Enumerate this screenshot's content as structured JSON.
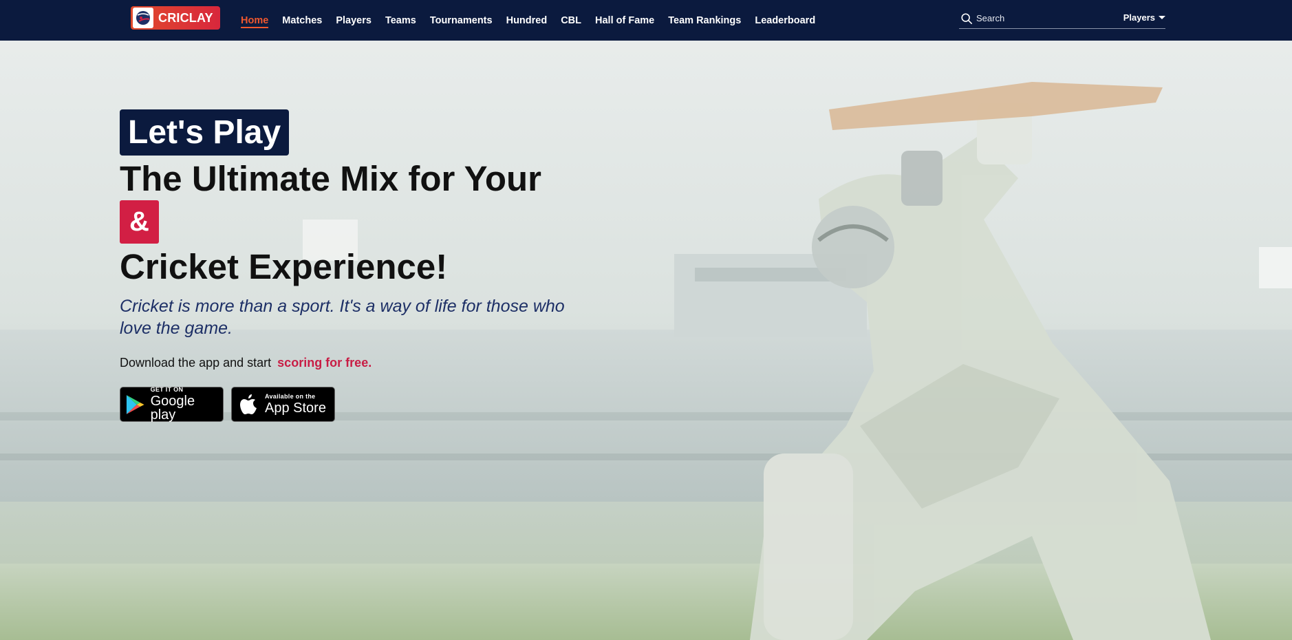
{
  "nav": {
    "logo_text": "CRICLAY",
    "items": [
      {
        "label": "Home",
        "active": true
      },
      {
        "label": "Matches"
      },
      {
        "label": "Players"
      },
      {
        "label": "Teams"
      },
      {
        "label": "Tournaments"
      },
      {
        "label": "Hundred"
      },
      {
        "label": "CBL"
      },
      {
        "label": "Hall of Fame"
      },
      {
        "label": "Team Rankings"
      },
      {
        "label": "Leaderboard"
      }
    ],
    "search": {
      "placeholder": "Search",
      "icon": "search-icon"
    },
    "scope": {
      "label": "Players",
      "icon": "chevron-down-icon"
    }
  },
  "hero": {
    "badge": "Let's Play",
    "headline_line1": "The Ultimate Mix for Your",
    "ampersand": "&",
    "headline_line2": "Cricket Experience!",
    "tagline": "Cricket is more than a sport. It's a way of life for those who love the game.",
    "download_text": "Download the app and start",
    "download_highlight": "scoring for free.",
    "stores": {
      "google": {
        "small": "GET IT ON",
        "big": "Google play",
        "icon": "google-play-icon"
      },
      "apple": {
        "small": "Available on the",
        "big": "App Store",
        "icon": "apple-icon"
      }
    }
  },
  "colors": {
    "nav_bg": "#0b1a3e",
    "accent_orange": "#f0582e",
    "accent_red": "#d21f44",
    "tagline": "#1d2f66"
  }
}
